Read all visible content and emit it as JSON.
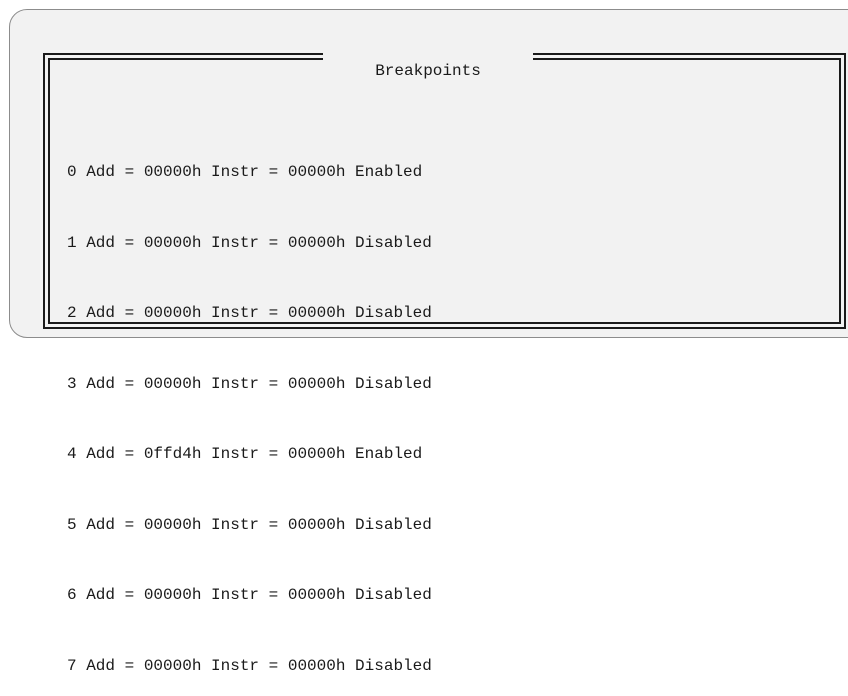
{
  "panel": {
    "title": "Breakpoints"
  },
  "breakpoints": [
    {
      "text": "0 Add = 00000h Instr = 00000h Enabled"
    },
    {
      "text": "1 Add = 00000h Instr = 00000h Disabled"
    },
    {
      "text": "2 Add = 00000h Instr = 00000h Disabled"
    },
    {
      "text": "3 Add = 00000h Instr = 00000h Disabled"
    },
    {
      "text": "4 Add = 0ffd4h Instr = 00000h Enabled"
    },
    {
      "text": "5 Add = 00000h Instr = 00000h Disabled"
    },
    {
      "text": "6 Add = 00000h Instr = 00000h Disabled"
    },
    {
      "text": "7 Add = 00000h Instr = 00000h Disabled"
    }
  ],
  "colors": {
    "background": "#f2f2f2",
    "text": "#1a1a1a",
    "border": "#1a1a1a"
  }
}
